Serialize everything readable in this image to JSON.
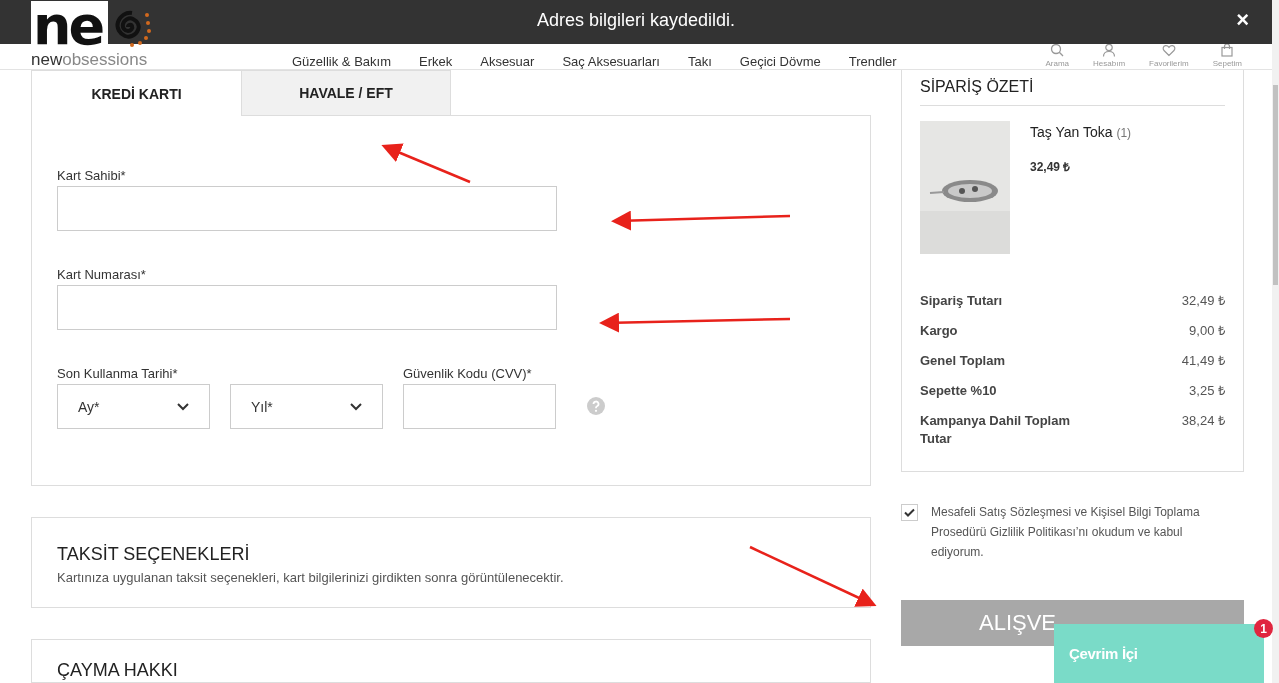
{
  "notification": {
    "message": "Adres bilgileri kaydedildi.",
    "close": "×"
  },
  "logo": {
    "mark": "ne",
    "tagline": "**new**obsessions"
  },
  "nav": [
    "Güzellik & Bakım",
    "Erkek",
    "Aksesuar",
    "Saç Aksesuarları",
    "Takı",
    "Geçici Dövme",
    "Trendler"
  ],
  "header_icons": [
    {
      "kind": "search",
      "label": "Arama"
    },
    {
      "kind": "account",
      "label": "Hesabım"
    },
    {
      "kind": "favorites",
      "label": "Favorilerim"
    },
    {
      "kind": "cart",
      "label": "Sepetim"
    }
  ],
  "tabs": [
    {
      "label": "KREDİ KARTI",
      "selected": true
    },
    {
      "label": "HAVALE / EFT",
      "selected": false
    }
  ],
  "card_form": {
    "holder_label": "Kart Sahibi*",
    "number_label": "Kart Numarası*",
    "expiry_label": "Son Kullanma Tarihi*",
    "month_placeholder": "Ay*",
    "year_placeholder": "Yıl*",
    "cvv_label": "Güvenlik Kodu (CVV)*"
  },
  "installments": {
    "title": "TAKSİT SEÇENEKLERİ",
    "text": "Kartınıza uygulanan taksit seçenekleri, kart bilgilerinizi girdikten sonra görüntülenecektir."
  },
  "withdrawal": {
    "title": "ÇAYMA HAKKI"
  },
  "summary": {
    "title": "SİPARİŞ ÖZETİ",
    "product": {
      "kind": "picture",
      "name": "Taş Yan Toka",
      "quantity": "(1)",
      "price": "32,49 ₺"
    },
    "totals": [
      {
        "label": "Sipariş Tutarı",
        "value": "32,49 ₺"
      },
      {
        "label": "Kargo",
        "value": "9,00 ₺"
      },
      {
        "label": "Genel Toplam",
        "value": "41,49 ₺"
      },
      {
        "label": "Sepette %10",
        "value": "3,25 ₺"
      },
      {
        "label": "Kampanya Dahil Toplam Tutar",
        "value": "38,24 ₺"
      }
    ]
  },
  "agreement": {
    "checked": true,
    "text": "Mesafeli Satış Sözleşmesi ve Kişisel Bilgi Toplama Prosedürü Gizlilik Politikası’nı okudum ve kabul ediyorum."
  },
  "checkout_button": "ALIŞVE",
  "chat": {
    "label": "Çevrim İçi",
    "badge": "1"
  }
}
